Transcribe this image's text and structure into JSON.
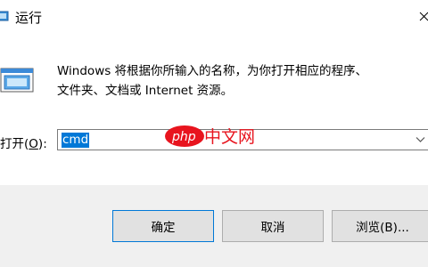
{
  "window": {
    "title": "运行"
  },
  "description": {
    "line1": "Windows 将根据你所输入的名称，为你打开相应的程序、",
    "line2": "文件夹、文档或 Internet 资源。"
  },
  "open": {
    "label_prefix": "打开(",
    "label_hotkey": "O",
    "label_suffix": "):",
    "value": "cmd"
  },
  "buttons": {
    "ok": "确定",
    "cancel": "取消",
    "browse": "浏览(B)..."
  },
  "watermark": {
    "text_latin": "php",
    "text_cn": "中文网"
  },
  "colors": {
    "accent": "#0078d7",
    "footer_bg": "#f0f0f0",
    "button_bg": "#e1e1e1",
    "watermark_red": "#e8141e"
  }
}
